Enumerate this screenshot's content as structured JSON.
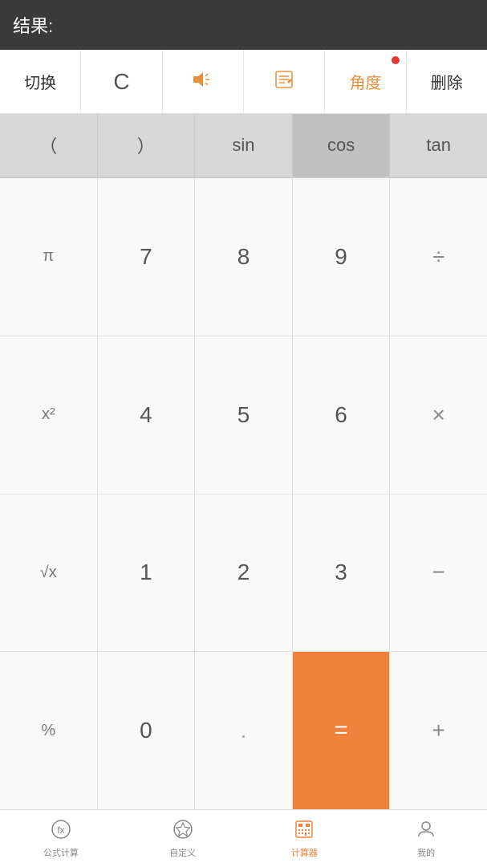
{
  "result_bar": {
    "label": "结果:"
  },
  "control_row": {
    "buttons": [
      {
        "id": "switch",
        "label": "切换",
        "color": "normal"
      },
      {
        "id": "clear",
        "label": "C",
        "color": "normal"
      },
      {
        "id": "sound",
        "label": "◁≋",
        "color": "orange"
      },
      {
        "id": "edit",
        "label": "✎",
        "color": "orange"
      },
      {
        "id": "angle",
        "label": "角度",
        "color": "orange",
        "dot": true
      },
      {
        "id": "delete",
        "label": "删除",
        "color": "normal"
      }
    ]
  },
  "trig_row": {
    "buttons": [
      {
        "id": "lparen",
        "label": "（"
      },
      {
        "id": "rparen",
        "label": "）"
      },
      {
        "id": "sin",
        "label": "sin"
      },
      {
        "id": "cos",
        "label": "cos",
        "selected": true
      },
      {
        "id": "tan",
        "label": "tan"
      }
    ]
  },
  "keypad": {
    "rows": [
      [
        {
          "id": "pi",
          "label": "π",
          "type": "special"
        },
        {
          "id": "7",
          "label": "7"
        },
        {
          "id": "8",
          "label": "8"
        },
        {
          "id": "9",
          "label": "9"
        },
        {
          "id": "divide",
          "label": "÷",
          "type": "operator"
        }
      ],
      [
        {
          "id": "xsq",
          "label": "x²",
          "type": "special"
        },
        {
          "id": "4",
          "label": "4"
        },
        {
          "id": "5",
          "label": "5"
        },
        {
          "id": "6",
          "label": "6"
        },
        {
          "id": "multiply",
          "label": "×",
          "type": "operator"
        }
      ],
      [
        {
          "id": "sqrt",
          "label": "√x",
          "type": "special"
        },
        {
          "id": "1",
          "label": "1"
        },
        {
          "id": "2",
          "label": "2"
        },
        {
          "id": "3",
          "label": "3"
        },
        {
          "id": "minus",
          "label": "−",
          "type": "operator"
        }
      ],
      [
        {
          "id": "percent",
          "label": "%",
          "type": "special"
        },
        {
          "id": "0",
          "label": "0"
        },
        {
          "id": "dot",
          "label": ".",
          "type": "gray"
        },
        {
          "id": "equals",
          "label": "=",
          "type": "equals"
        },
        {
          "id": "plus",
          "label": "+",
          "type": "operator"
        }
      ]
    ]
  },
  "bottom_nav": {
    "items": [
      {
        "id": "formula",
        "label": "公式计算",
        "icon": "fx",
        "active": false
      },
      {
        "id": "custom",
        "label": "自定义",
        "icon": "star",
        "active": false
      },
      {
        "id": "calculator",
        "label": "计算器",
        "icon": "grid",
        "active": true
      },
      {
        "id": "mine",
        "label": "我的",
        "icon": "person",
        "active": false
      }
    ]
  }
}
